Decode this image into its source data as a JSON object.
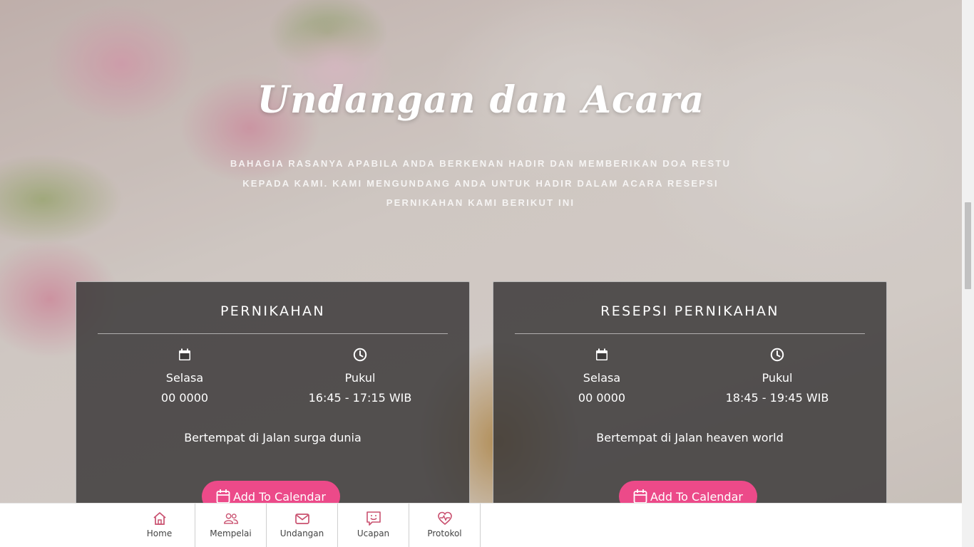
{
  "section": {
    "title": "Undangan dan Acara",
    "subtitle": "Bahagia rasanya apabila Anda berkenan hadir dan memberikan doa restu kepada kami. Kami mengundang Anda untuk hadir dalam acara resepsi pernikahan kami berikut ini"
  },
  "events": [
    {
      "title": "PERNIKAHAN",
      "day_label": "Selasa",
      "date": "00 0000",
      "time_label": "Pukul",
      "time": "16:45 - 17:15 WIB",
      "venue": "Bertempat di Jalan surga dunia",
      "button_label": "Add To Calendar"
    },
    {
      "title": "RESEPSI PERNIKAHAN",
      "day_label": "Selasa",
      "date": "00 0000",
      "time_label": "Pukul",
      "time": "18:45 - 19:45 WIB",
      "venue": "Bertempat di Jalan heaven world",
      "button_label": "Add To Calendar"
    }
  ],
  "icons": {
    "date": "calendar-icon",
    "time": "clock-icon",
    "button": "calendar-outline-icon"
  },
  "bottom_nav": [
    {
      "label": "Home",
      "icon": "home-icon"
    },
    {
      "label": "Mempelai",
      "icon": "users-icon"
    },
    {
      "label": "Undangan",
      "icon": "envelope-icon"
    },
    {
      "label": "Ucapan",
      "icon": "chat-smile-icon"
    },
    {
      "label": "Protokol",
      "icon": "heart-pulse-icon"
    }
  ],
  "colors": {
    "accent": "#ec4a89",
    "nav_icon": "#c9506f",
    "card_bg": "#3c3a3a"
  }
}
